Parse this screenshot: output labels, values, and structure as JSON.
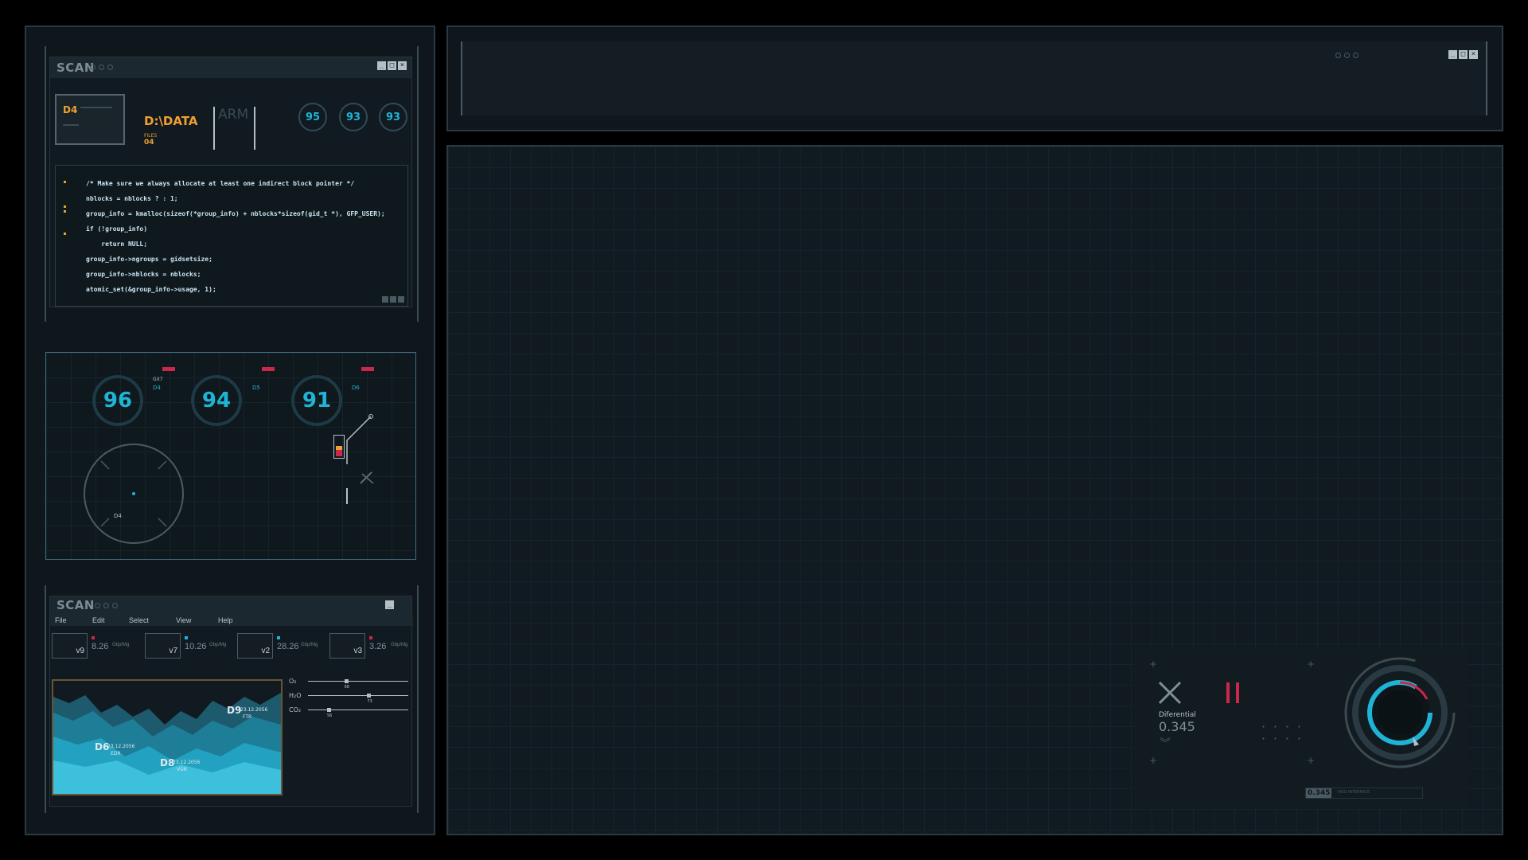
{
  "scan_window": {
    "title": "SCAN",
    "drive_label": "D4",
    "path": "D:\\DATA",
    "files_label": "FILES",
    "files_count": "04",
    "arm_label": "ARM",
    "gauges": [
      "95",
      "93",
      "93"
    ],
    "code_lines": [
      "/* Make sure we always allocate at least one indirect block pointer */",
      "nblocks = nblocks ? : 1;",
      "group_info = kmalloc(sizeof(*group_info) + nblocks*sizeof(gid_t *), GFP_USER);",
      "if (!group_info)",
      "    return NULL;",
      "group_info->ngroups = gidsetsize;",
      "group_info->nblocks = nblocks;",
      "atomic_set(&group_info->usage, 1);"
    ]
  },
  "radar_panel": {
    "gauges": [
      {
        "value": "96",
        "tag": "GX7",
        "sub": "D4"
      },
      {
        "value": "94",
        "tag": "",
        "sub": "D5"
      },
      {
        "value": "91",
        "tag": "",
        "sub": "D6"
      }
    ],
    "radar_label": "D4"
  },
  "scan_window_2": {
    "title": "SCAN",
    "menu": [
      "File",
      "Edit",
      "Select",
      "View",
      "Help"
    ],
    "cards": [
      {
        "label": "v9",
        "value": "8.26",
        "unit": "Gbp/Mg"
      },
      {
        "label": "v7",
        "value": "10.26",
        "unit": "Gbp/Mg"
      },
      {
        "label": "v2",
        "value": "28.26",
        "unit": "Gbp/Mg"
      },
      {
        "label": "v3",
        "value": "3.26",
        "unit": "Gbp/Mg"
      }
    ],
    "chart_points": [
      {
        "name": "D9",
        "date": "23.12.2056",
        "code": "FTR"
      },
      {
        "name": "D6",
        "date": "23.12.2056",
        "code": "EDR"
      },
      {
        "name": "D8",
        "date": "23.12.2056",
        "code": "VGR"
      }
    ],
    "gases": [
      {
        "label": "O₂",
        "value": "68",
        "level": 0.38
      },
      {
        "label": "H₂O",
        "value": "73",
        "level": 0.62
      },
      {
        "label": "CO₂",
        "value": "56",
        "level": 0.2
      }
    ]
  },
  "hud": {
    "diff_label": "Diferential",
    "diff_value": "0.345",
    "readout_value": "0.345",
    "readout_caption": "HUD INTERFACE"
  },
  "colors": {
    "accent_cyan": "#1fb4d6",
    "accent_orange": "#f0a030",
    "accent_red": "#c9284b"
  }
}
